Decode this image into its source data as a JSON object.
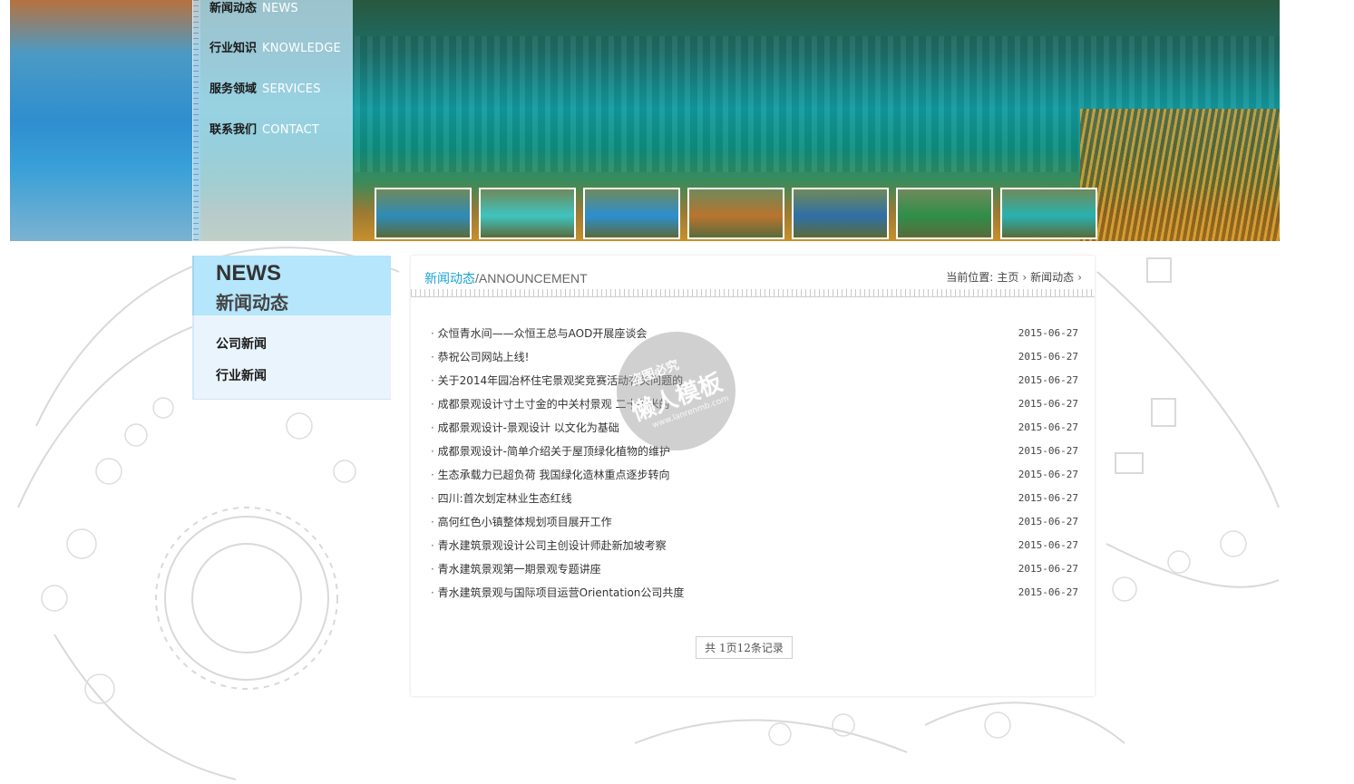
{
  "nav": [
    {
      "cn": "新闻动态",
      "en": "NEWS"
    },
    {
      "cn": "行业知识",
      "en": "KNOWLEDGE"
    },
    {
      "cn": "服务领域",
      "en": "SERVICES"
    },
    {
      "cn": "联系我们",
      "en": "CONTACT"
    }
  ],
  "thumbnail_colors": [
    "#2e8bb8",
    "#3fc4c0",
    "#2c8fd0",
    "#b9742e",
    "#2f6fa8",
    "#2f8e4a",
    "#29b1b0"
  ],
  "sidebar": {
    "heading_en": "NEWS",
    "heading_cn": "新闻动态",
    "links": [
      "公司新闻",
      "行业新闻"
    ]
  },
  "main": {
    "title_highlight": "新闻动态",
    "title_rest": "/ANNOUNCEMENT",
    "breadcrumb": {
      "label": "当前位置:",
      "home": "主页",
      "current": "新闻动态"
    },
    "news": [
      {
        "title": "众恒青水间——众恒王总与AOD开展座谈会",
        "date": "2015-06-27"
      },
      {
        "title": "恭祝公司网站上线!",
        "date": "2015-06-27"
      },
      {
        "title": "关于2014年园冶杯住宅景观奖竞赛活动有关问题的",
        "date": "2015-06-27"
      },
      {
        "title": "成都景观设计寸土寸金的中关村景观 二十平米的",
        "date": "2015-06-27"
      },
      {
        "title": "成都景观设计-景观设计 以文化为基础",
        "date": "2015-06-27"
      },
      {
        "title": "成都景观设计-简单介绍关于屋顶绿化植物的维护",
        "date": "2015-06-27"
      },
      {
        "title": "生态承载力已超负荷 我国绿化造林重点逐步转向",
        "date": "2015-06-27"
      },
      {
        "title": "四川:首次划定林业生态红线",
        "date": "2015-06-27"
      },
      {
        "title": "高何红色小镇整体规划项目展开工作",
        "date": "2015-06-27"
      },
      {
        "title": "青水建筑景观设计公司主创设计师赴新加坡考察",
        "date": "2015-06-27"
      },
      {
        "title": "青水建筑景观第一期景观专题讲座",
        "date": "2015-06-27"
      },
      {
        "title": "青水建筑景观与国际项目运营Orientation公司共度",
        "date": "2015-06-27"
      }
    ],
    "pager": "共 1页12条记录"
  },
  "watermark": {
    "line1": "盗图必究",
    "line2": "懒人模板",
    "line3": "www.lanrenmb.com"
  }
}
